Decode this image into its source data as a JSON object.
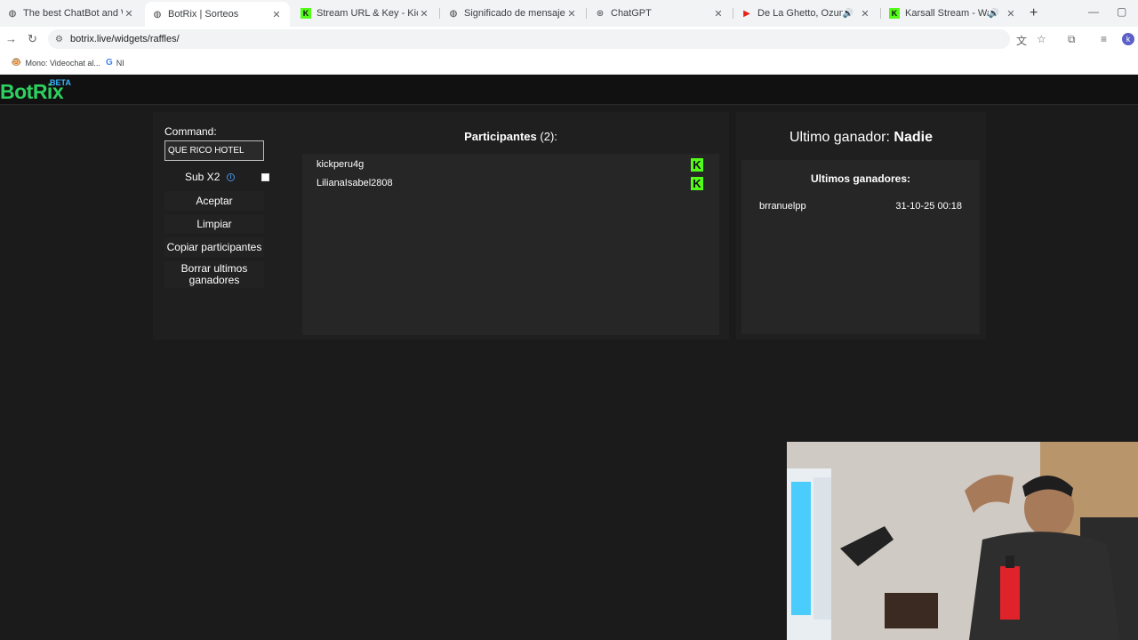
{
  "browser": {
    "tabs": [
      {
        "title": "The best ChatBot and Widgets",
        "icon": "globe-icon",
        "active": false
      },
      {
        "title": "BotRix | Sorteos",
        "icon": "globe-icon",
        "active": true
      },
      {
        "title": "Stream URL & Key - Kick Dashb",
        "icon": "kick-icon",
        "active": false
      },
      {
        "title": "Significado de mensaje FiveM",
        "icon": "globe-icon",
        "active": false
      },
      {
        "title": "ChatGPT",
        "icon": "chatgpt-icon",
        "active": false
      },
      {
        "title": "De La Ghetto, Ozuna, Neng",
        "icon": "youtube-icon",
        "active": false
      },
      {
        "title": "Karsall Stream - Watch Live",
        "icon": "kick-icon",
        "active": false
      }
    ],
    "url": "botrix.live/widgets/raffles/",
    "bookmarks": [
      {
        "label": "Mono: Videochat al...",
        "icon": "monkey-icon"
      },
      {
        "label": "NI",
        "icon": "google-icon"
      }
    ],
    "profile_initial": "k"
  },
  "site": {
    "logo": "BotRix",
    "badge": "BETA"
  },
  "raffle": {
    "command_label": "Command:",
    "command_value": "QUE RICO HOTEL",
    "sub_label": "Sub X2",
    "sub_checked": false,
    "buttons": {
      "accept": "Aceptar",
      "clear": "Limpiar",
      "copy": "Copiar participantes",
      "delete_line1": "Borrar ultimos",
      "delete_line2": "ganadores"
    }
  },
  "participants": {
    "title": "Participantes",
    "count": "(2):",
    "list": [
      {
        "name": "kickperu4g",
        "platform": "kick-icon"
      },
      {
        "name": "LilianaIsabel2808",
        "platform": "kick-icon"
      }
    ]
  },
  "winners": {
    "last_label": "Ultimo ganador:",
    "last_value": "Nadie",
    "title": "Ultimos ganadores:",
    "list": [
      {
        "name": "brranuelpp",
        "date": "31-10-25 00:18"
      }
    ]
  },
  "colors": {
    "brand_green": "#2ed160",
    "kick_green": "#53fc18",
    "beta_blue": "#38b6ff",
    "background": "#1b1b1b"
  }
}
